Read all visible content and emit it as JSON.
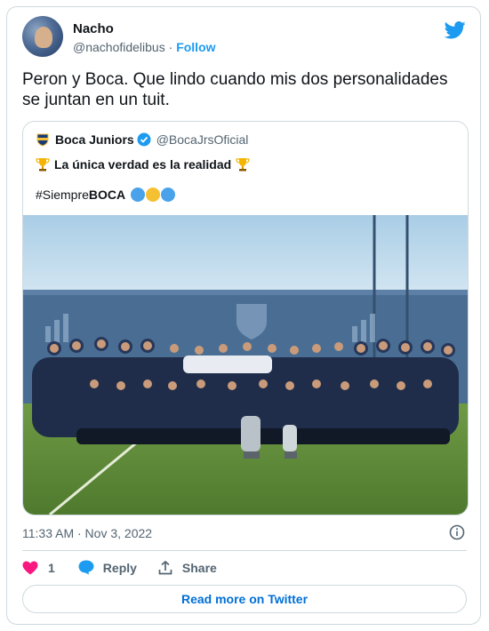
{
  "author": {
    "name": "Nacho",
    "handle": "@nachofidelibus",
    "separator": "·",
    "follow_label": "Follow"
  },
  "tweet": {
    "text": "Peron y Boca. Que lindo cuando mis dos personalidades se juntan en un tuit."
  },
  "quoted": {
    "name": "Boca Juniors",
    "handle": "@BocaJrsOficial",
    "line1": "La única verdad es la realidad",
    "hashtag_prefix": "#Siempre",
    "hashtag_bold": "BOCA",
    "dot_colors": [
      "#4aa3ea",
      "#f6c033",
      "#4aa3ea"
    ]
  },
  "meta": {
    "timestamp": "11:33 AM · Nov 3, 2022"
  },
  "actions": {
    "like_count": "1",
    "reply_label": "Reply",
    "share_label": "Share"
  },
  "footer": {
    "read_more_label": "Read more on Twitter"
  },
  "colors": {
    "brand_blue": "#1d9bf0",
    "like_red": "#f91880",
    "link_blue": "#006fd6"
  }
}
